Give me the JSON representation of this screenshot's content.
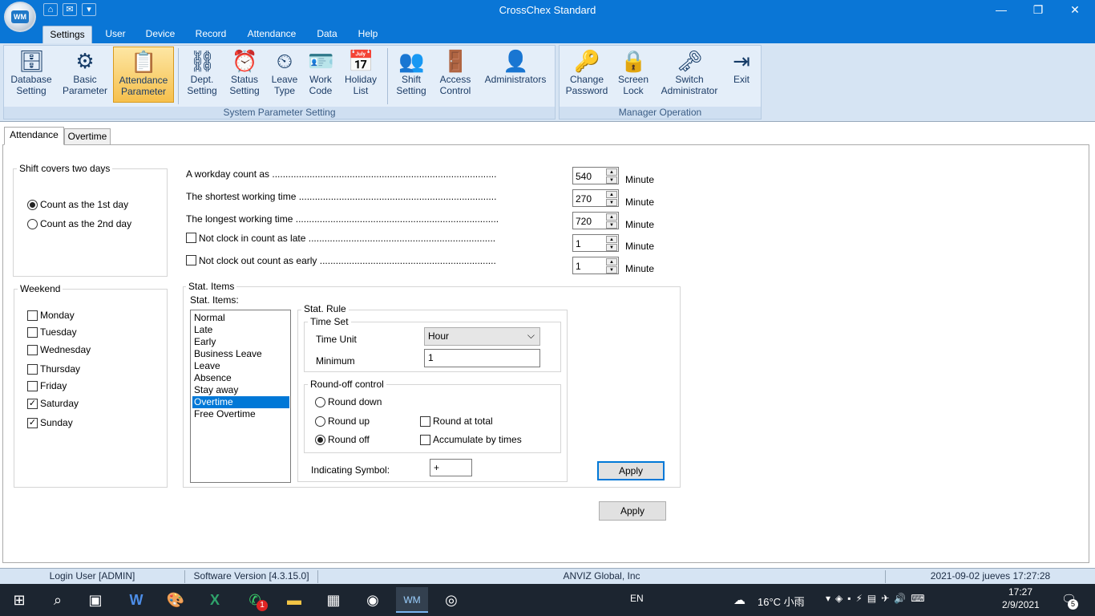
{
  "window": {
    "title": "CrossChex Standard"
  },
  "menu_tabs": [
    "Settings",
    "User",
    "Device",
    "Record",
    "Attendance",
    "Data",
    "Help"
  ],
  "ribbon": {
    "groups": [
      {
        "label": "System Parameter Setting"
      },
      {
        "label": "Manager Operation"
      }
    ],
    "buttons": [
      {
        "line1": "Database",
        "line2": "Setting",
        "icon": "database-icon"
      },
      {
        "line1": "Basic",
        "line2": "Parameter",
        "icon": "gear-flask-icon"
      },
      {
        "line1": "Attendance",
        "line2": "Parameter",
        "icon": "clipboard-icon"
      },
      {
        "line1": "Dept.",
        "line2": "Setting",
        "icon": "org-chart-icon"
      },
      {
        "line1": "Status",
        "line2": "Setting",
        "icon": "alarm-clock-icon"
      },
      {
        "line1": "Leave",
        "line2": "Type",
        "icon": "alarm-clock-check-icon"
      },
      {
        "line1": "Work",
        "line2": "Code",
        "icon": "badge-icon"
      },
      {
        "line1": "Holiday",
        "line2": "List",
        "icon": "calendar-icon"
      },
      {
        "line1": "Shift",
        "line2": "Setting",
        "icon": "shift-icon"
      },
      {
        "line1": "Access",
        "line2": "Control",
        "icon": "door-icon"
      },
      {
        "line1": "Administrators",
        "line2": "",
        "icon": "admin-gear-icon"
      },
      {
        "line1": "Change",
        "line2": "Password",
        "icon": "key-icon"
      },
      {
        "line1": "Screen",
        "line2": "Lock",
        "icon": "user-lock-icon"
      },
      {
        "line1": "Switch",
        "line2": "Administrator",
        "icon": "switch-key-icon"
      },
      {
        "line1": "Exit",
        "line2": "",
        "icon": "exit-icon"
      }
    ]
  },
  "page_tabs": [
    "Attendance",
    "Overtime"
  ],
  "shift": {
    "legend": "Shift covers two days",
    "options": [
      "Count as the 1st day",
      "Count as the 2nd day"
    ],
    "selected": 0
  },
  "weekend": {
    "legend": "Weekend",
    "days": [
      {
        "label": "Monday",
        "checked": false
      },
      {
        "label": "Tuesday",
        "checked": false
      },
      {
        "label": "Wednesday",
        "checked": false
      },
      {
        "label": "Thursday",
        "checked": false
      },
      {
        "label": "Friday",
        "checked": false
      },
      {
        "label": "Saturday",
        "checked": true
      },
      {
        "label": "Sunday",
        "checked": true
      }
    ]
  },
  "rules": [
    {
      "label": "A workday count as ....................................................................................",
      "value": "540",
      "unit": "Minute"
    },
    {
      "label": "The shortest working time ..........................................................................",
      "value": "270",
      "unit": "Minute"
    },
    {
      "label": "The longest working time ............................................................................",
      "value": "720",
      "unit": "Minute"
    },
    {
      "label": "Not clock in count as late ......................................................................",
      "value": "1",
      "unit": "Minute"
    },
    {
      "label": "Not clock out count as early ..................................................................",
      "value": "1",
      "unit": "Minute"
    }
  ],
  "stat": {
    "legend": "Stat. Items",
    "list_label": "Stat. Items:",
    "items": [
      "Normal",
      "Late",
      "Early",
      "Business Leave",
      "Leave",
      "Absence",
      "Stay away",
      "Overtime",
      "Free Overtime"
    ],
    "selected": "Overtime",
    "rule_legend": "Stat. Rule",
    "time_set_legend": "Time Set",
    "time_unit_label": "Time Unit",
    "time_unit_value": "Hour",
    "minimum_label": "Minimum",
    "minimum_value": "1",
    "roundoff_legend": "Round-off control",
    "round_down": "Round down",
    "round_up": "Round up",
    "round_off": "Round off",
    "round_at_total": "Round at total",
    "accumulate": "Accumulate by times",
    "indicating_label": "Indicating Symbol:",
    "indicating_value": "+",
    "apply": "Apply"
  },
  "apply_main": "Apply",
  "status": {
    "login": "Login User [ADMIN]",
    "version": "Software Version [4.3.15.0]",
    "company": "ANVIZ Global, Inc",
    "datetime": "2021-09-02 jueves 17:27:28"
  },
  "taskbar": {
    "lang": "EN",
    "weather": "16°C  小雨",
    "time": "17:27",
    "date": "2/9/2021",
    "whatsapp_badge": "1",
    "notif_count": "5"
  }
}
